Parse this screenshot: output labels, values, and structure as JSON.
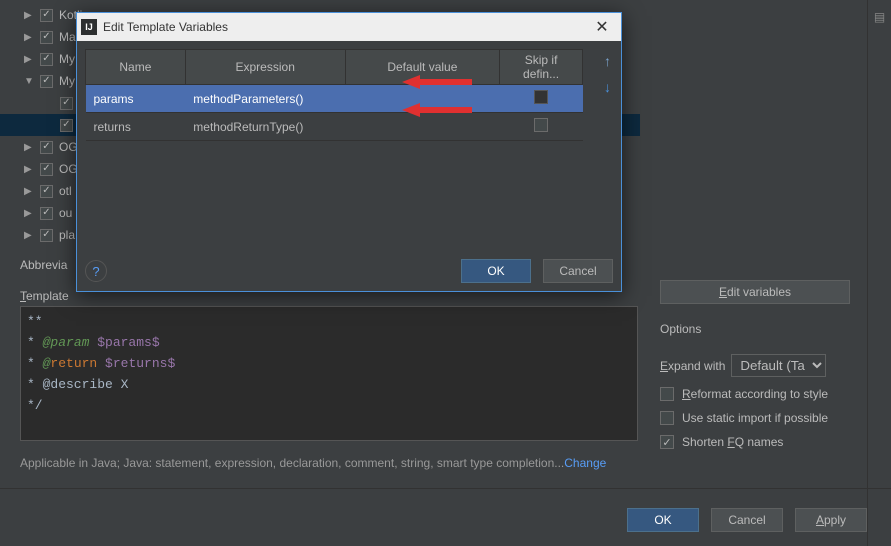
{
  "tree": {
    "items": [
      {
        "label": "Kotlin",
        "arrow": "▶",
        "checked": true,
        "indent": 0,
        "selected": false
      },
      {
        "label": "Ma",
        "arrow": "▶",
        "checked": true,
        "indent": 0,
        "selected": false
      },
      {
        "label": "My",
        "arrow": "▶",
        "checked": true,
        "indent": 0,
        "selected": false
      },
      {
        "label": "My",
        "arrow": "▼",
        "checked": true,
        "indent": 0,
        "selected": false
      },
      {
        "label": "",
        "arrow": "",
        "checked": true,
        "indent": 1,
        "selected": false
      },
      {
        "label": "",
        "arrow": "",
        "checked": true,
        "indent": 1,
        "selected": true
      },
      {
        "label": "OG",
        "arrow": "▶",
        "checked": true,
        "indent": 0,
        "selected": false
      },
      {
        "label": "OG",
        "arrow": "▶",
        "checked": true,
        "indent": 0,
        "selected": false
      },
      {
        "label": "otl",
        "arrow": "▶",
        "checked": true,
        "indent": 0,
        "selected": false
      },
      {
        "label": "ou",
        "arrow": "▶",
        "checked": true,
        "indent": 0,
        "selected": false
      },
      {
        "label": "pla",
        "arrow": "▶",
        "checked": true,
        "indent": 0,
        "selected": false
      }
    ]
  },
  "labels": {
    "abbreviation": "Abbrevia",
    "template_text": "Template",
    "options": "Options",
    "expand_with": "Expand with",
    "edit_variables_u": "E",
    "edit_variables_rest": "dit variables",
    "expand_with_u": "E",
    "expand_with_rest": "xpand with",
    "reformat_u": "R",
    "reformat_rest": "eformat according to style",
    "static_import": "Use static import if possible",
    "shorten_fq_u1": "Shorten ",
    "shorten_fq_u2": "F",
    "shorten_fq_u3": "Q names",
    "apply_u": "A",
    "apply_rest": "pply"
  },
  "code": {
    "line1": "**",
    "line2_prefix": "* ",
    "line2_tag": "@param",
    "line2_var": " $params$",
    "line3_prefix": "* ",
    "line3_at": "@",
    "line3_tag": "return",
    "line3_var": " $returns$",
    "line4": "* @describe X",
    "line5": "*/"
  },
  "applicable": {
    "text": "Applicable in Java; Java: statement, expression, declaration, comment, string, smart type completion...",
    "link": "Change"
  },
  "expand_option": "Default (Tab)",
  "checkboxes": {
    "reformat": false,
    "static_import": false,
    "shorten_fq": true
  },
  "main_buttons": {
    "ok": "OK",
    "cancel": "Cancel",
    "apply": "Apply"
  },
  "modal": {
    "title": "Edit Template Variables",
    "icon_text": "IJ",
    "headers": {
      "name": "Name",
      "expression": "Expression",
      "default_value": "Default value",
      "skip": "Skip if defin..."
    },
    "rows": [
      {
        "name": "params",
        "expression": "methodParameters()",
        "default": "",
        "skip": false,
        "selected": true
      },
      {
        "name": "returns",
        "expression": "methodReturnType()",
        "default": "",
        "skip": false,
        "selected": false
      }
    ],
    "buttons": {
      "ok": "OK",
      "cancel": "Cancel"
    },
    "help": "?"
  }
}
